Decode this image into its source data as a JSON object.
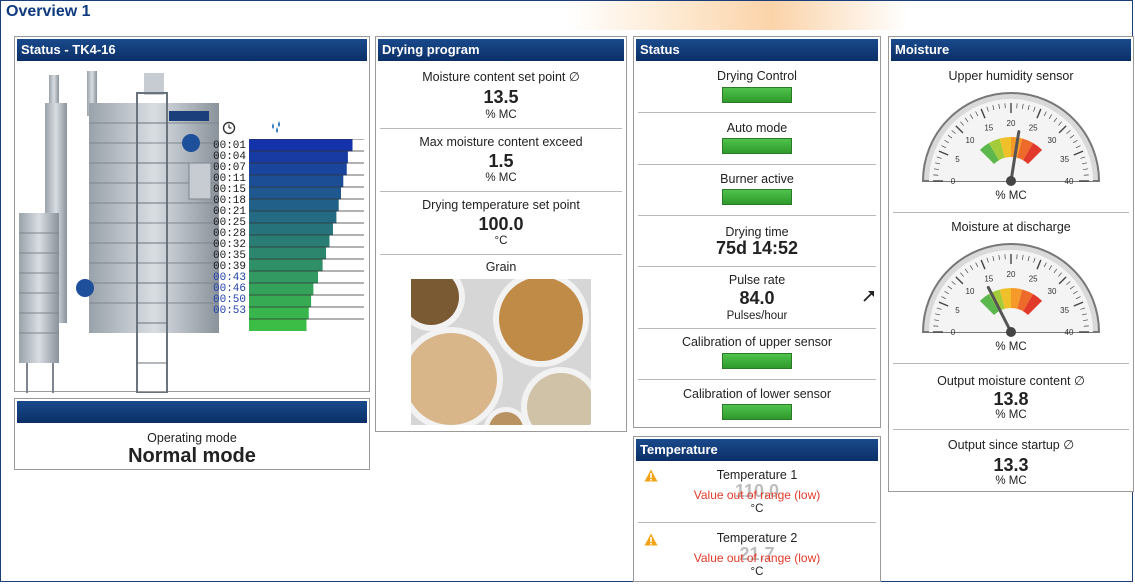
{
  "page": {
    "title": "Overview 1"
  },
  "status_panel": {
    "title": "Status - TK4-16",
    "dryer_brand": "VESTA",
    "timeline": [
      "00:01",
      "00:04",
      "00:07",
      "00:11",
      "00:15",
      "00:18",
      "00:21",
      "00:25",
      "00:28",
      "00:32",
      "00:35",
      "00:39",
      "00:43",
      "00:46",
      "00:50",
      "00:53"
    ],
    "moisture_bars_fraction": [
      0.9,
      0.86,
      0.85,
      0.82,
      0.8,
      0.78,
      0.76,
      0.73,
      0.7,
      0.67,
      0.64,
      0.6,
      0.56,
      0.54,
      0.52,
      0.5
    ],
    "clock_icon": "clock-icon",
    "drops_icon": "water-drops-icon"
  },
  "mode_panel": {
    "title": "",
    "label": "Operating mode",
    "value": "Normal mode"
  },
  "drying_program": {
    "title": "Drying program",
    "items": [
      {
        "label": "Moisture content set point ∅",
        "value": "13.5",
        "unit": "% MC"
      },
      {
        "label": "Max moisture content exceed",
        "value": "1.5",
        "unit": "% MC"
      },
      {
        "label": "Drying temperature set point",
        "value": "100.0",
        "unit": "°C"
      }
    ],
    "grain_label": "Grain"
  },
  "status": {
    "title": "Status",
    "drying_control": "Drying Control",
    "auto_mode": "Auto mode",
    "burner_active": "Burner active",
    "drying_time_label": "Drying time",
    "drying_time_value": "75d 14:52",
    "pulse_rate_label": "Pulse rate",
    "pulse_rate_value": "84.0",
    "pulse_rate_unit": "Pulses/hour",
    "cal_upper": "Calibration of upper sensor",
    "cal_lower": "Calibration of lower sensor",
    "trend_icon": "trend-arrow-icon"
  },
  "temperature": {
    "title": "Temperature",
    "items": [
      {
        "label": "Temperature 1",
        "ghost_value": "110.0",
        "warning": "Value out of range (low)",
        "unit": "°C"
      },
      {
        "label": "Temperature 2",
        "ghost_value": "21.7",
        "warning": "Value out of range (low)",
        "unit": "°C"
      }
    ]
  },
  "moisture": {
    "title": "Moisture",
    "upper_label": "Upper humidity sensor",
    "upper_unit": "% MC",
    "upper_gauge_value": 22,
    "discharge_label": "Moisture at discharge",
    "discharge_unit": "% MC",
    "discharge_gauge_value": 14,
    "gauge_ticks": [
      "0",
      "5",
      "10",
      "15",
      "20",
      "25",
      "30",
      "35",
      "40"
    ],
    "output_label": "Output moisture content ∅",
    "output_value": "13.8",
    "output_unit": "% MC",
    "startup_label": "Output since startup ∅",
    "startup_value": "13.3",
    "startup_unit": "% MC"
  }
}
